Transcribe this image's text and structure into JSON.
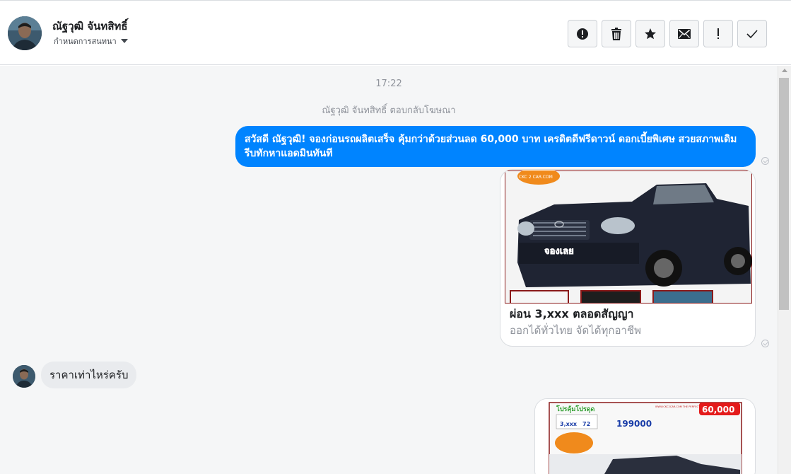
{
  "header": {
    "contact_name": "ณัฐวุฒิ จันทสิทธิ์",
    "assign_label": "กำหนดการสนทนา",
    "actions": [
      {
        "name": "mark-spam-button",
        "icon": "alert-circle-icon"
      },
      {
        "name": "delete-button",
        "icon": "trash-icon"
      },
      {
        "name": "star-button",
        "icon": "star-icon"
      },
      {
        "name": "mark-unread-button",
        "icon": "envelope-icon"
      },
      {
        "name": "follow-up-button",
        "icon": "exclamation-icon"
      },
      {
        "name": "mark-done-button",
        "icon": "check-icon"
      }
    ]
  },
  "thread": {
    "timestamp": "17:22",
    "system_note": "ณัฐวุฒิ จันทสิทธิ์ ตอบกลับโฆษณา",
    "outgoing_message": "สวัสดี ณัฐวุฒิ! จองก่อนรถผลิตเสร็จ คุ้มกว่าด้วยส่วนลด 60,000 บาท เครดิตดีฟรีดาวน์ ดอกเบี้ยพิเศษ สวยสภาพเดิม รีบทักหาแอดมินทันที",
    "ad_card": {
      "title": "ผ่อน 3,xxx ตลอดสัญญา",
      "subtitle": "ออกได้ทั่วไทย จัดได้ทุกอาชีพ",
      "image_badge": "CKC 2 CAR.COM",
      "image_cta": "จองเลย"
    },
    "incoming_message": "ราคาเท่าไหร่ครับ",
    "ad_card_2": {
      "headline": "โปรคุ้มโปรดุด",
      "site": "WWW.CKC2CAR.COM THE PERFECT CHOICE OF USED CAR",
      "price_main": "199000",
      "discount": "60,000",
      "installment": "3,xxx",
      "months": "72"
    }
  },
  "colors": {
    "outgoing_bubble": "#0084ff",
    "incoming_bubble": "#e9ebee",
    "thread_bg": "#f5f6f7"
  }
}
